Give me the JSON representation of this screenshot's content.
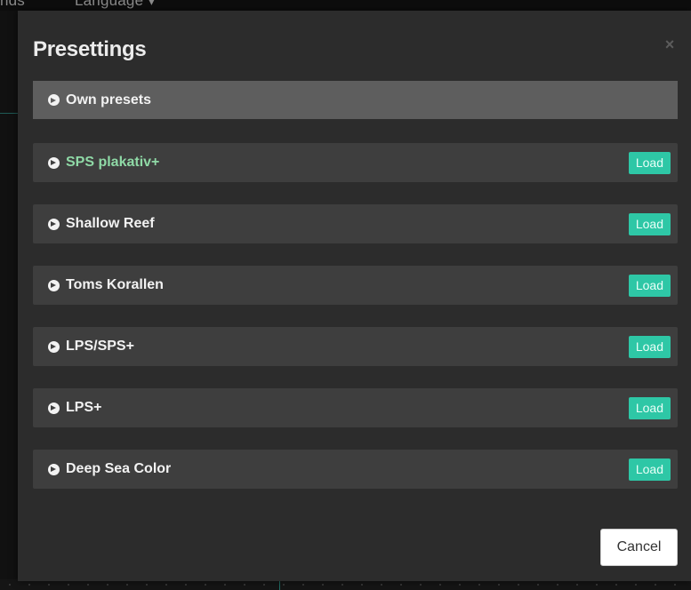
{
  "nav": {
    "item1": "nds",
    "item2": "Language ▾"
  },
  "modal": {
    "title": "Presettings",
    "close_glyph": "×",
    "own_presets_label": "Own presets",
    "presets": [
      {
        "name": "SPS plakativ+",
        "load_label": "Load",
        "active": true
      },
      {
        "name": "Shallow Reef",
        "load_label": "Load",
        "active": false
      },
      {
        "name": "Toms Korallen",
        "load_label": "Load",
        "active": false
      },
      {
        "name": "LPS/SPS+",
        "load_label": "Load",
        "active": false
      },
      {
        "name": "LPS+",
        "load_label": "Load",
        "active": false
      },
      {
        "name": "Deep Sea Color",
        "load_label": "Load",
        "active": false
      }
    ],
    "cancel_label": "Cancel"
  },
  "colors": {
    "accent": "#2ec7a6",
    "active_text": "#8fd9a6",
    "modal_bg": "#2c2c2c",
    "row_bg": "#3e3e3e"
  },
  "icons": {
    "row_chevron": "chevron-circle-right-icon",
    "close": "close-icon"
  }
}
